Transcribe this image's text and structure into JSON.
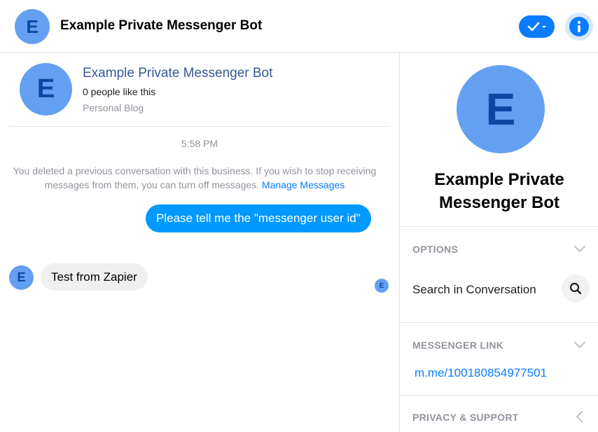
{
  "header": {
    "avatar_letter": "E",
    "title": "Example Private Messenger Bot"
  },
  "page_card": {
    "avatar_letter": "E",
    "name": "Example Private Messenger Bot",
    "likes": "0 people like this",
    "category": "Personal Blog"
  },
  "conversation": {
    "timestamp": "5:58 PM",
    "notice_text": "You deleted a previous conversation with this business. If you wish to stop receiving messages from them, you can turn off messages.",
    "notice_link": "Manage Messages",
    "messages": [
      {
        "direction": "outgoing",
        "text": "Please tell me the \"messenger user id\""
      },
      {
        "direction": "incoming",
        "avatar_letter": "E",
        "text": "Test from Zapier"
      }
    ],
    "read_receipt_letter": "E"
  },
  "panel": {
    "avatar_letter": "E",
    "name": "Example Private Messenger Bot",
    "options_title": "OPTIONS",
    "search_label": "Search in Conversation",
    "messenger_link_title": "MESSENGER LINK",
    "messenger_link": "m.me/100180854977501",
    "privacy_title": "PRIVACY & SUPPORT"
  },
  "colors": {
    "accent": "#0a7cff",
    "outgoing_bubble": "#0099ff",
    "avatar_bg": "#63a0f2",
    "avatar_letter": "#0d47a1"
  },
  "icons": {
    "check_button": "check-dropdown-icon",
    "info_button": "info-icon",
    "search": "search-icon",
    "chevron_down": "chevron-down-icon",
    "chevron_left": "chevron-left-icon"
  }
}
